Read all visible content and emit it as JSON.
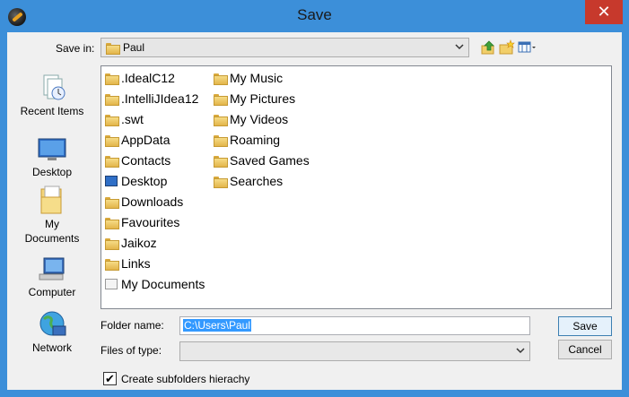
{
  "window": {
    "title": "Save",
    "close_glyph": "✕"
  },
  "toolbar": {
    "save_in_label": "Save in:",
    "save_in_value": "Paul",
    "icons": [
      "up-folder-icon",
      "new-folder-icon",
      "view-menu-icon"
    ]
  },
  "places": [
    {
      "label": "Recent Items",
      "icon": "recent-items-icon"
    },
    {
      "label": "Desktop",
      "icon": "desktop-icon"
    },
    {
      "label": "My Documents",
      "icon": "my-documents-icon"
    },
    {
      "label": "Computer",
      "icon": "computer-icon"
    },
    {
      "label": "Network",
      "icon": "network-icon"
    }
  ],
  "files": {
    "column1": [
      ".IdealC12",
      ".IntelliJIdea12",
      ".swt",
      "AppData",
      "Contacts",
      "Desktop",
      "Downloads",
      "Favourites",
      "Jaikoz",
      "Links",
      "My Documents"
    ],
    "column2": [
      "My Music",
      "My Pictures",
      "My Videos",
      "Roaming",
      "Saved Games",
      "Searches"
    ]
  },
  "form": {
    "folder_name_label": "Folder name:",
    "folder_name_value": "C:\\Users\\Paul",
    "files_of_type_label": "Files of type:",
    "files_of_type_value": "",
    "save_label": "Save",
    "cancel_label": "Cancel",
    "subfolders_label": "Create subfolders hierachy",
    "subfolders_checked": true,
    "check_glyph": "✔"
  },
  "colors": {
    "titlebar": "#3c8fd9",
    "close": "#c7392c",
    "selection": "#3399ff"
  }
}
